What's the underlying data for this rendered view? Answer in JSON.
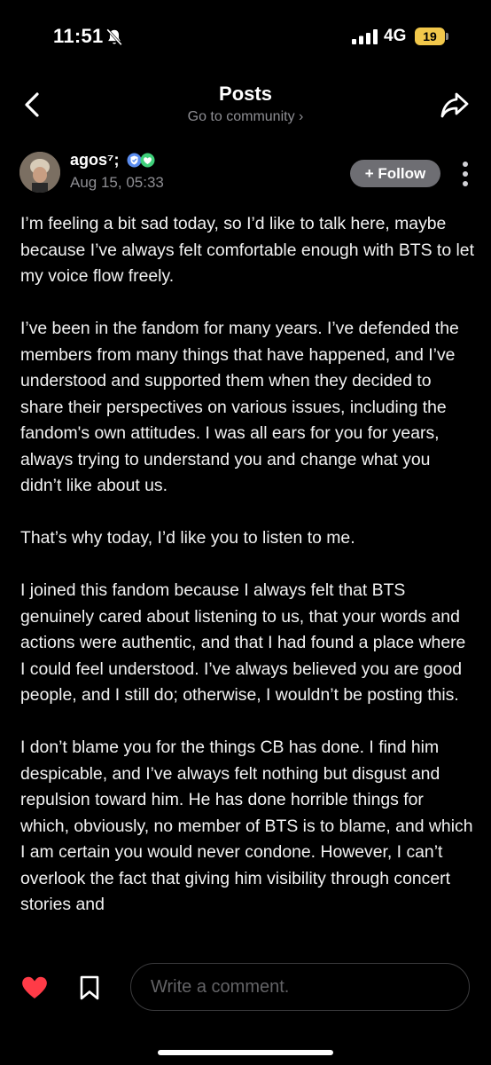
{
  "status_bar": {
    "time": "11:51",
    "network": "4G",
    "battery": "19",
    "battery_color": "#f2c84b"
  },
  "header": {
    "title": "Posts",
    "community_link": "Go to community ›"
  },
  "author": {
    "name": "agos⁷;",
    "date": "Aug 15, 05:33",
    "badges": [
      "shield-badge-icon",
      "heart-badge-icon"
    ],
    "badge_colors": [
      "#5b8def",
      "#3fd07a"
    ]
  },
  "actions": {
    "follow_label": "+ Follow"
  },
  "post": {
    "paragraphs": [
      "I’m feeling a bit sad today, so I’d like to talk here, maybe because I’ve always felt comfortable enough with BTS to let my voice flow freely.",
      "I’ve been in the fandom for many years. I’ve defended the members from many things that have happened, and I’ve understood and supported them when they decided to share their perspectives on various issues, including the fandom's own attitudes. I was all ears for you for years, always trying to understand you and change what you didn’t like about us.",
      "That’s why today, I’d like you to listen to me.",
      "I joined this fandom because I always felt that BTS genuinely cared about listening to us, that your words and actions were authentic, and that I had found a place where I could feel understood. I’ve always believed you are good people, and I still do; otherwise, I wouldn’t be posting this.",
      "I don’t blame you for the things CB has done. I find him despicable, and I’ve always felt nothing but disgust and repulsion toward him. He has done horrible things for which, obviously, no member of BTS is to blame, and which I am certain you would never condone. However, I can’t overlook the fact that giving him visibility through concert stories and"
    ]
  },
  "bottom_bar": {
    "comment_placeholder": "Write a comment.",
    "heart_color": "#ff3b47"
  }
}
